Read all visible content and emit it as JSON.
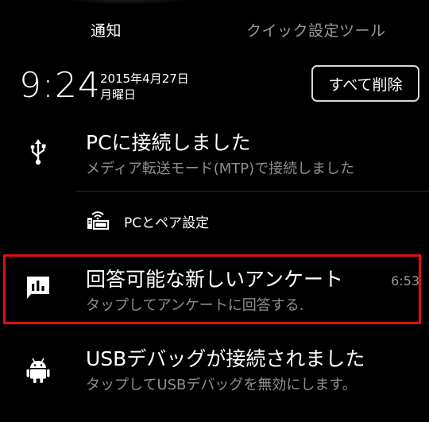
{
  "tabs": {
    "notifications": "通知",
    "quick_settings": "クイック設定ツール"
  },
  "header": {
    "time": "9:24",
    "date_line1": "2015年4月27日",
    "date_line2": "月曜日",
    "clear_all": "すべて削除"
  },
  "notifications": [
    {
      "icon": "usb-icon",
      "title": "PCに接続しました",
      "subtitle": "メディア転送モード(MTP)で接続しました",
      "time": "",
      "action": {
        "icon": "pc-pair-icon",
        "label": "PCとペア設定"
      }
    },
    {
      "icon": "survey-icon",
      "title": "回答可能な新しいアンケート",
      "subtitle": "タップしてアンケートに回答する.",
      "time": "6:53",
      "highlighted": true
    },
    {
      "icon": "android-icon",
      "title": "USBデバッグが接続されました",
      "subtitle": "タップしてUSBデバッグを無効にします。",
      "time": ""
    }
  ],
  "colors": {
    "background": "#000000",
    "text_primary": "#ffffff",
    "text_secondary": "#8f8f8f",
    "highlight_border": "#e01010"
  }
}
